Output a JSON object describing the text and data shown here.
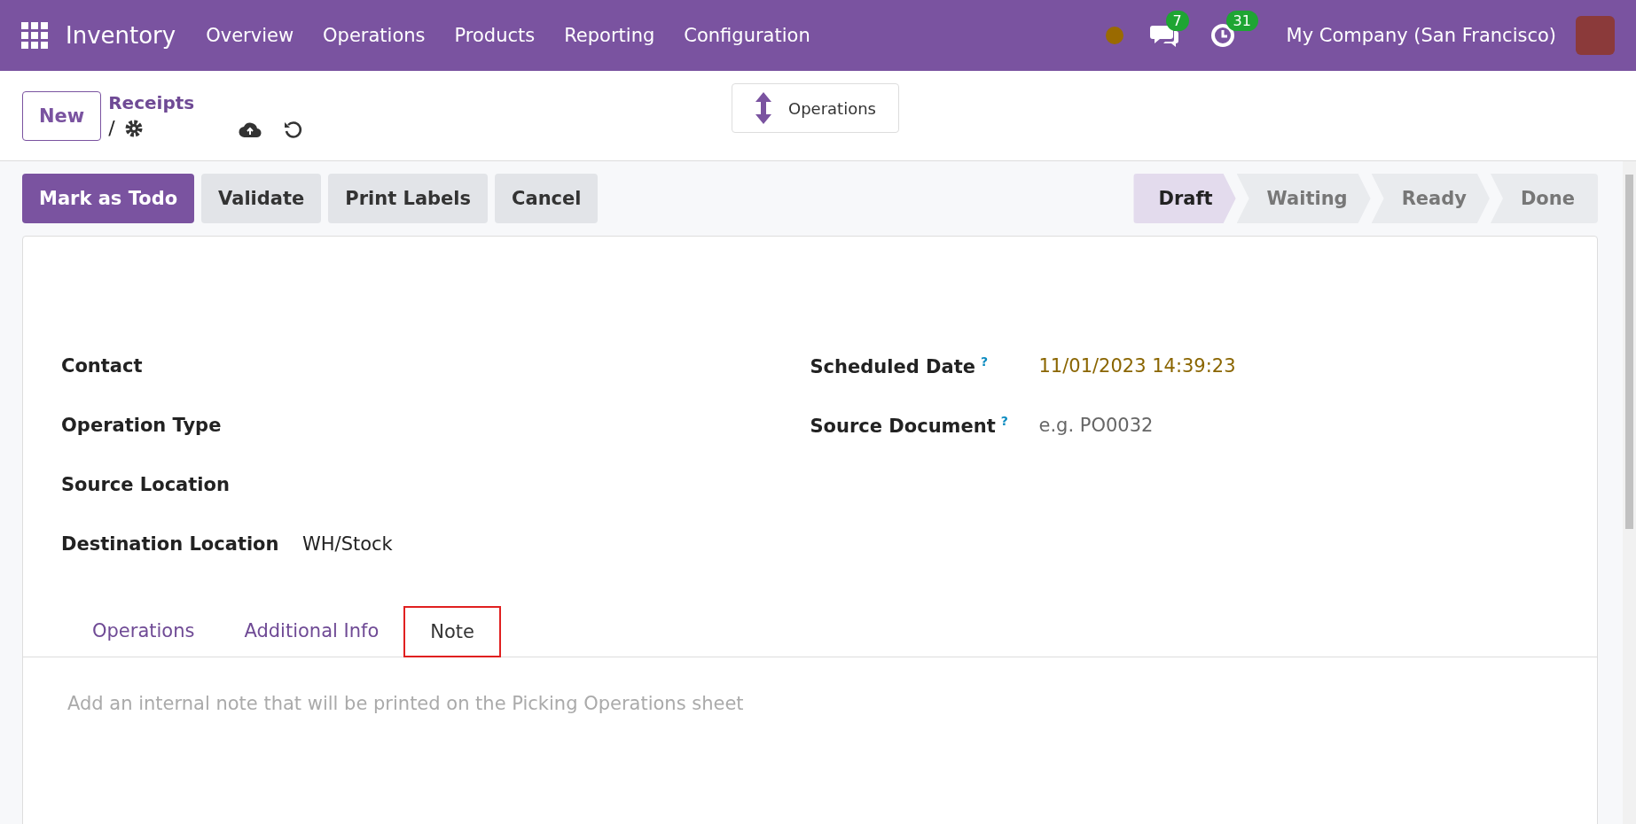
{
  "navbar": {
    "app_name": "Inventory",
    "menu": [
      "Overview",
      "Operations",
      "Products",
      "Reporting",
      "Configuration"
    ],
    "messages_count": "7",
    "activities_count": "31",
    "company": "My Company (San Francisco)"
  },
  "control_panel": {
    "new_button": "New",
    "breadcrumb": "Receipts",
    "separator": "/",
    "smart_button": "Operations"
  },
  "actions": [
    {
      "label": "Mark as Todo",
      "kind": "primary"
    },
    {
      "label": "Validate",
      "kind": "secondary"
    },
    {
      "label": "Print Labels",
      "kind": "secondary"
    },
    {
      "label": "Cancel",
      "kind": "secondary"
    }
  ],
  "status_steps": [
    {
      "label": "Draft",
      "selected": true
    },
    {
      "label": "Waiting",
      "selected": false
    },
    {
      "label": "Ready",
      "selected": false
    },
    {
      "label": "Done",
      "selected": false
    }
  ],
  "left_fields": [
    {
      "label": "Contact"
    },
    {
      "label": "Operation Type"
    },
    {
      "label": "Source Location"
    },
    {
      "label": "Destination Location",
      "value": "WH/Stock"
    }
  ],
  "right_fields": [
    {
      "label": "Scheduled Date",
      "help": "?",
      "value": "11/01/2023 14:39:23"
    },
    {
      "label": "Source Document",
      "help": "?",
      "placeholder": "e.g. PO0032"
    }
  ],
  "tabs": [
    {
      "label": "Operations",
      "selected": false
    },
    {
      "label": "Additional Info",
      "selected": false
    },
    {
      "label": "Note",
      "selected": true
    }
  ],
  "note": {
    "placeholder": "Add an internal note that will be printed on the Picking Operations sheet"
  }
}
